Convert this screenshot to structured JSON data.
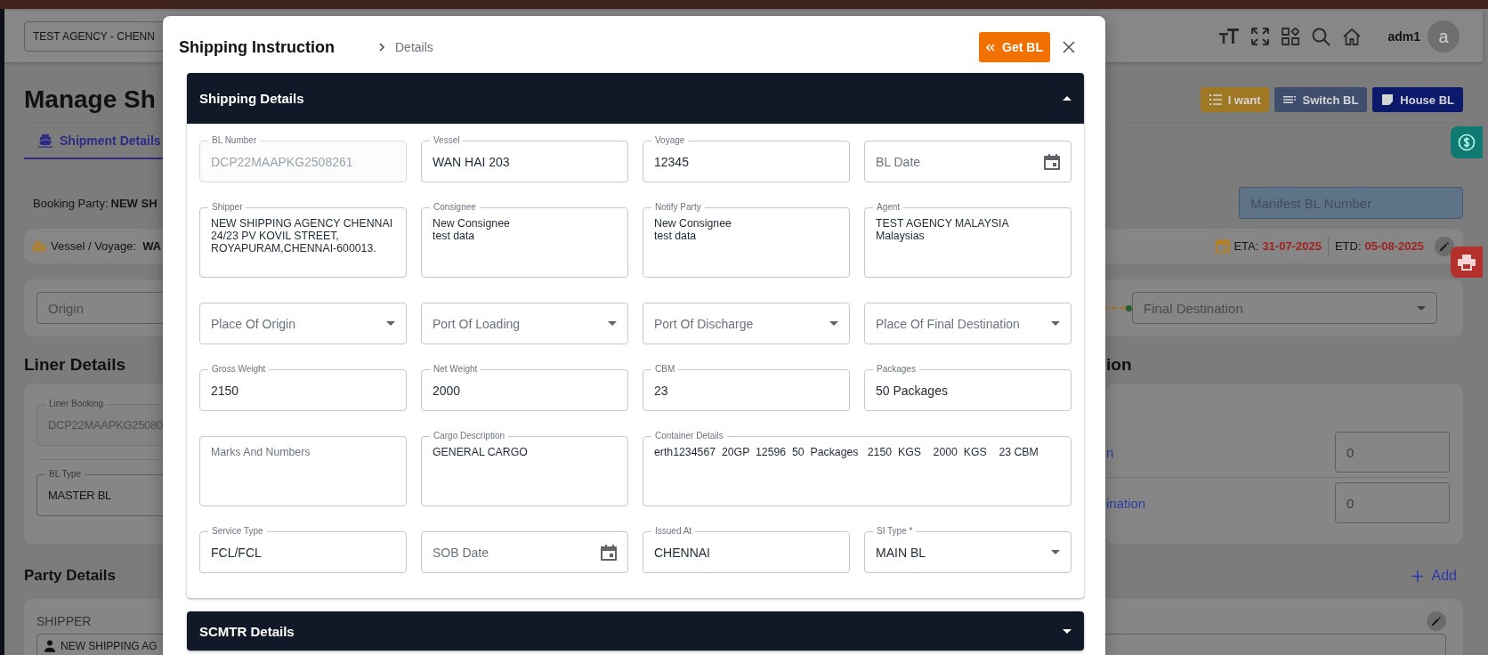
{
  "background": {
    "agency_select": {
      "value": "TEST AGENCY - CHENN"
    },
    "user": {
      "name": "adm1",
      "initial": "a"
    },
    "page_title": "Manage Sh",
    "action_buttons": [
      {
        "label": "I want",
        "color": "#a07722"
      },
      {
        "label": "Switch BL",
        "color": "#3e4e6c"
      },
      {
        "label": "House BL",
        "color": "#0c1a6b"
      }
    ],
    "tabs": [
      {
        "label": "Shipment Details",
        "selected": true
      }
    ],
    "booking_party": {
      "label": "Booking Party:",
      "value": "NEW SH"
    },
    "manifest_bl": {
      "placeholder": "Manifest BL Number"
    },
    "vessel": {
      "label": "Vessel / Voyage:",
      "value": "WA",
      "eta_label": "ETA:",
      "eta": "31-07-2025",
      "etd_label": "ETD:",
      "etd": "05-08-2025"
    },
    "route": {
      "origin": {
        "placeholder": "Origin"
      },
      "final_destination": {
        "placeholder": "Final Destination"
      }
    },
    "liner_details": {
      "heading": "Liner Details",
      "fields": [
        {
          "label": "Liner Booking",
          "value": "DCP22MAAPKG25080",
          "disabled": true
        },
        {
          "label": "BL Type",
          "value": "MASTER BL",
          "disabled": false
        }
      ]
    },
    "side_section": {
      "heading": "ion",
      "rows": [
        {
          "link": "n",
          "placeholder": "0"
        },
        {
          "link": "ination",
          "placeholder": "0"
        }
      ]
    },
    "party_details": {
      "heading": "Party Details",
      "add_label": "Add",
      "parties": [
        {
          "label": "SHIPPER",
          "value": "NEW SHIPPING AG"
        }
      ]
    }
  },
  "dialog": {
    "title": "Shipping Instruction",
    "breadcrumb": "Details",
    "get_bl": "Get BL",
    "sections": [
      {
        "title": "Shipping Details",
        "expanded": true,
        "fields": [
          {
            "kind": "text",
            "label": "BL Number",
            "value": "DCP22MAAPKG2508261",
            "disabled": true
          },
          {
            "kind": "text",
            "label": "Vessel",
            "value": "WAN HAI 203",
            "disabled": false
          },
          {
            "kind": "text",
            "label": "Voyage",
            "value": "12345",
            "disabled": false
          },
          {
            "kind": "date",
            "placeholder": "BL Date",
            "disabled": false
          },
          {
            "kind": "textarea",
            "label": "Shipper",
            "value": "NEW SHIPPING AGENCY CHENNAI\n24/23 PV KOVIL STREET,\nROYAPURAM,CHENNAI-600013.",
            "disabled": false
          },
          {
            "kind": "textarea",
            "label": "Consignee",
            "value": "New Consignee\ntest data",
            "disabled": false
          },
          {
            "kind": "textarea",
            "label": "Notify Party",
            "value": "New Consignee\ntest data",
            "disabled": false
          },
          {
            "kind": "textarea",
            "label": "Agent",
            "value": "TEST AGENCY MALAYSIA\nMalaysias",
            "disabled": false
          },
          {
            "kind": "select",
            "placeholder": "Place Of Origin",
            "disabled": false
          },
          {
            "kind": "select",
            "placeholder": "Port Of Loading",
            "disabled": false
          },
          {
            "kind": "select",
            "placeholder": "Port Of Discharge",
            "disabled": false
          },
          {
            "kind": "select",
            "placeholder": "Place Of Final Destination",
            "disabled": false
          },
          {
            "kind": "text",
            "label": "Gross Weight",
            "value": "2150",
            "disabled": false
          },
          {
            "kind": "text",
            "label": "Net Weight",
            "value": "2000",
            "disabled": false
          },
          {
            "kind": "text",
            "label": "CBM",
            "value": "23",
            "disabled": false
          },
          {
            "kind": "text",
            "label": "Packages",
            "value": "50 Packages",
            "disabled": false
          },
          {
            "kind": "textarea",
            "placeholder": "Marks And Numbers",
            "disabled": false
          },
          {
            "kind": "textarea",
            "label": "Cargo Description",
            "value": "GENERAL CARGO",
            "disabled": false
          },
          {
            "kind": "wide-textarea",
            "label": "Container Details",
            "value": "erth1234567  20GP  12596  50  Packages   2150  KGS    2000  KGS    23 CBM",
            "disabled": false
          },
          {
            "kind": "text",
            "label": "Service Type",
            "value": "FCL/FCL",
            "disabled": false
          },
          {
            "kind": "date",
            "placeholder": "SOB Date",
            "disabled": false
          },
          {
            "kind": "text",
            "label": "Issued At",
            "value": "CHENNAI",
            "disabled": false
          },
          {
            "kind": "select",
            "label": "SI Type *",
            "value": "MAIN BL",
            "disabled": false
          }
        ]
      },
      {
        "title": "SCMTR Details",
        "expanded": false
      }
    ]
  }
}
